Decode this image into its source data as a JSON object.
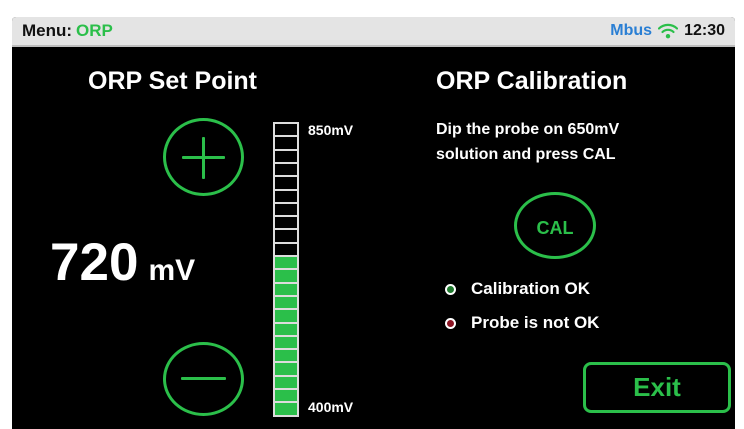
{
  "header": {
    "menu_label": "Menu:",
    "menu_value": "ORP",
    "bus_label": "Mbus",
    "wifi_icon": "wifi-icon",
    "time": "12:30"
  },
  "setpoint": {
    "title": "ORP Set Point",
    "value": "720",
    "unit": "mV",
    "increase_icon": "plus-icon",
    "decrease_icon": "minus-icon"
  },
  "level_bar": {
    "max_label": "850mV",
    "min_label": "400mV",
    "segments_total": 22,
    "segments_filled": 12
  },
  "calibration": {
    "title": "ORP Calibration",
    "instruction_line1": "Dip the probe on 650mV",
    "instruction_line2": "solution and press CAL",
    "cal_label": "CAL",
    "status_ok": "Calibration OK",
    "status_error": "Probe is not OK"
  },
  "colors": {
    "accent": "#2bbf4a",
    "ok_dot": "#1f7a2e",
    "error_dot": "#8b1322",
    "bus": "#2a7fd4"
  },
  "exit_label": "Exit"
}
